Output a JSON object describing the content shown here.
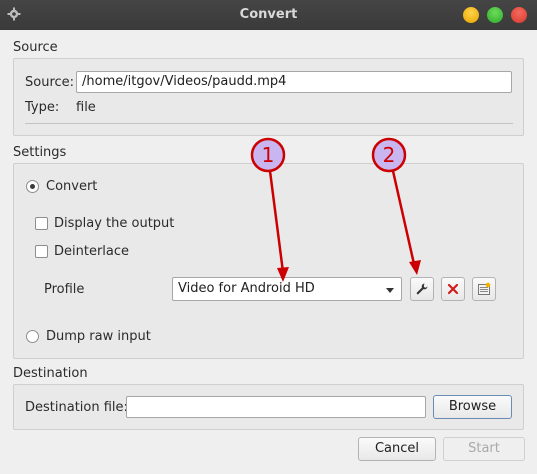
{
  "window": {
    "title": "Convert"
  },
  "source": {
    "section_label": "Source",
    "source_label": "Source:",
    "source_value": "/home/itgov/Videos/paudd.mp4",
    "type_label": "Type:",
    "type_value": "file"
  },
  "settings": {
    "section_label": "Settings",
    "convert_label": "Convert",
    "convert_selected": true,
    "display_output_label": "Display the output",
    "display_output_checked": false,
    "deinterlace_label": "Deinterlace",
    "deinterlace_checked": false,
    "profile_label": "Profile",
    "profile_selected": "Video for Android HD",
    "dump_raw_label": "Dump raw input"
  },
  "destination": {
    "section_label": "Destination",
    "file_label": "Destination file:",
    "file_value": "",
    "browse_label": "Browse"
  },
  "footer": {
    "cancel_label": "Cancel",
    "start_label": "Start"
  },
  "annotations": [
    {
      "number": "1",
      "color": "#cc0000",
      "fill": "#c9b5f0"
    },
    {
      "number": "2",
      "color": "#cc0000",
      "fill": "#c9b5f0"
    }
  ],
  "icons": {
    "edit_profile": "wrench-icon",
    "delete_profile": "delete-x-icon",
    "new_profile": "new-profile-icon",
    "window_menu": "gear-icon"
  },
  "colors": {
    "titlebar": "#3c3c3c",
    "minimize": "#f4b400",
    "maximize": "#3cb83a",
    "close": "#e8473c",
    "annotation": "#cc0000"
  }
}
